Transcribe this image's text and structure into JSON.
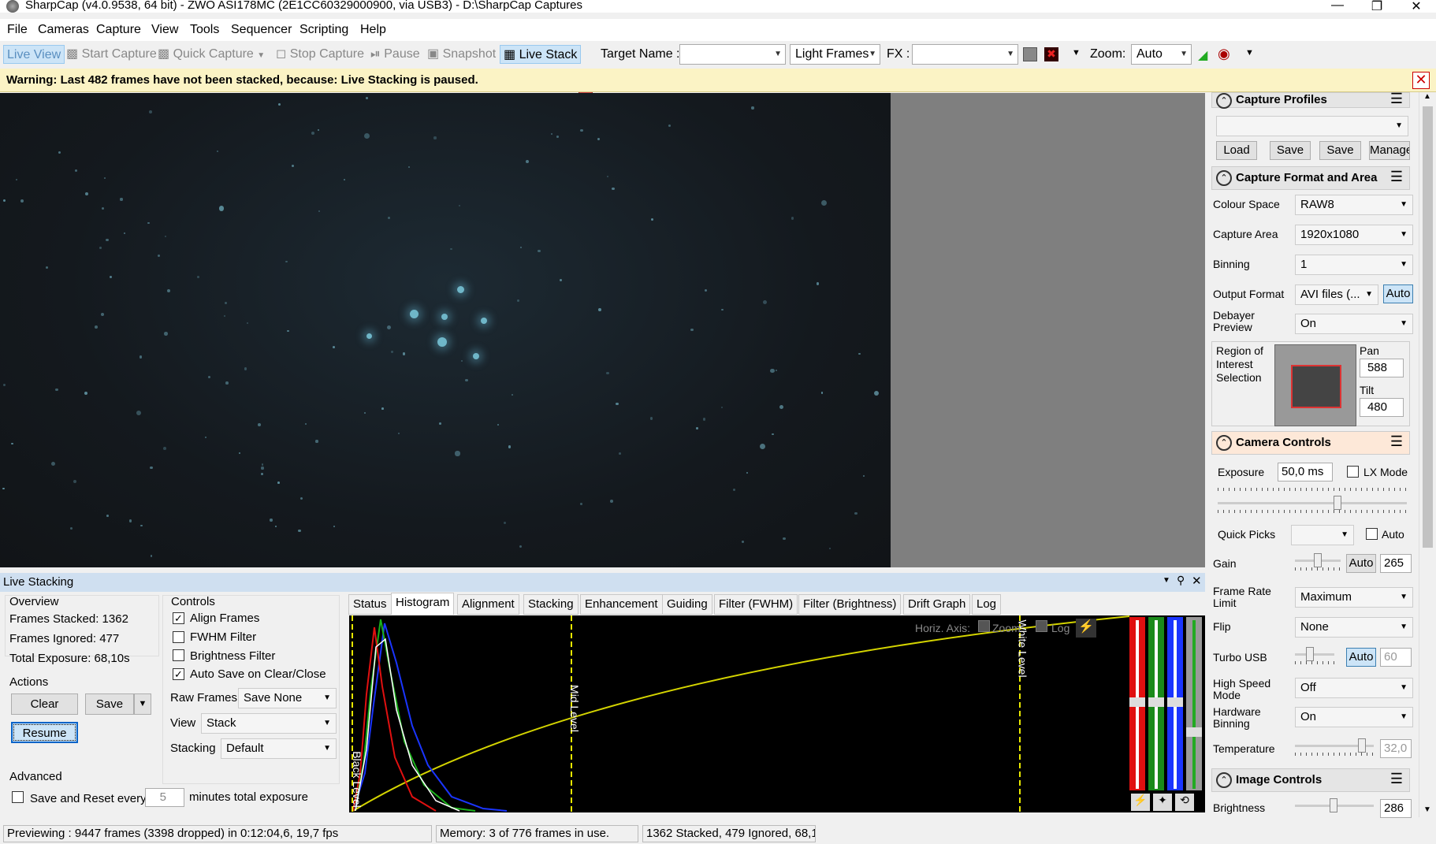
{
  "window": {
    "title": "SharpCap (v4.0.9538, 64 bit) - ZWO ASI178MC (2E1CC60329000900, via USB3) - D:\\SharpCap Captures"
  },
  "menu": [
    "File",
    "Cameras",
    "Capture",
    "View",
    "Tools",
    "Sequencer",
    "Scripting",
    "Help"
  ],
  "toolbar": {
    "live_view": "Live View",
    "start_capture": "Start Capture",
    "quick_capture": "Quick Capture",
    "stop_capture": "Stop Capture",
    "pause": "Pause",
    "snapshot": "Snapshot",
    "live_stack": "Live Stack",
    "target_name_label": "Target Name :",
    "target_name_value": "",
    "frame_type": "Light Frames",
    "fx_label": "FX :",
    "fx_value": "",
    "zoom_label": "Zoom:",
    "zoom_value": "Auto"
  },
  "warning": {
    "text": "Warning: Last 482 frames have not been stacked, because: Live Stacking is paused."
  },
  "right_panel": {
    "capture_profiles": {
      "title": "Capture Profiles",
      "profile": "",
      "load": "Load",
      "save": "Save",
      "save_as": "Save As",
      "manage": "Manage"
    },
    "capture_format": {
      "title": "Capture Format and Area",
      "colour_space_label": "Colour Space",
      "colour_space": "RAW8",
      "capture_area_label": "Capture Area",
      "capture_area": "1920x1080",
      "binning_label": "Binning",
      "binning": "1",
      "output_format_label": "Output Format",
      "output_format": "AVI files (...",
      "output_auto": "Auto",
      "debayer_label": "Debayer Preview",
      "debayer": "On",
      "roi_label": "Region of Interest Selection",
      "pan_label": "Pan",
      "pan": "588",
      "tilt_label": "Tilt",
      "tilt": "480"
    },
    "camera_controls": {
      "title": "Camera Controls",
      "exposure_label": "Exposure",
      "exposure": "50,0 ms",
      "lx_mode": "LX Mode",
      "quick_picks_label": "Quick Picks",
      "quick_picks_auto": "Auto",
      "gain_label": "Gain",
      "gain_auto": "Auto",
      "gain": "265",
      "frame_rate_label": "Frame Rate Limit",
      "frame_rate": "Maximum",
      "flip_label": "Flip",
      "flip": "None",
      "turbo_label": "Turbo USB",
      "turbo_auto": "Auto",
      "turbo": "60",
      "hsm_label": "High Speed Mode",
      "hsm": "Off",
      "hwbin_label": "Hardware Binning",
      "hwbin": "On",
      "temp_label": "Temperature",
      "temp": "32,0"
    },
    "image_controls": {
      "title": "Image Controls",
      "brightness_label": "Brightness",
      "brightness": "286"
    }
  },
  "live_stacking": {
    "title": "Live Stacking",
    "overview": {
      "title": "Overview",
      "frames_stacked": "Frames Stacked: 1362",
      "frames_ignored": "Frames Ignored: 477",
      "total_exposure": "Total Exposure:   68,10s"
    },
    "actions": {
      "title": "Actions",
      "clear": "Clear",
      "save": "Save",
      "resume": "Resume"
    },
    "advanced": {
      "title": "Advanced",
      "save_reset": "Save and Reset every",
      "minutes": "5",
      "minutes_label": "minutes total exposure"
    },
    "controls": {
      "title": "Controls",
      "align_frames": "Align Frames",
      "fwhm_filter": "FWHM Filter",
      "brightness_filter": "Brightness Filter",
      "auto_save": "Auto Save on Clear/Close",
      "raw_frames_label": "Raw Frames",
      "raw_frames": "Save None",
      "view_label": "View",
      "view": "Stack",
      "stacking_label": "Stacking",
      "stacking": "Default"
    },
    "tabs": [
      "Status",
      "Histogram",
      "Alignment",
      "Stacking",
      "Enhancement",
      "Guiding",
      "Filter (FWHM)",
      "Filter (Brightness)",
      "Drift Graph",
      "Log"
    ],
    "histogram": {
      "horiz_axis": "Horiz. Axis:",
      "zoom": "Zoom",
      "log": "Log",
      "black_level": "Black Level",
      "mid_level": "Mid Level",
      "white_level": "White Level"
    }
  },
  "status": {
    "preview": "Previewing : 9447 frames (3398 dropped) in 0:12:04,6, 19,7 fps",
    "memory": "Memory: 3 of 776 frames in use.",
    "stacked": "1362 Stacked, 479 Ignored, 68,1"
  }
}
